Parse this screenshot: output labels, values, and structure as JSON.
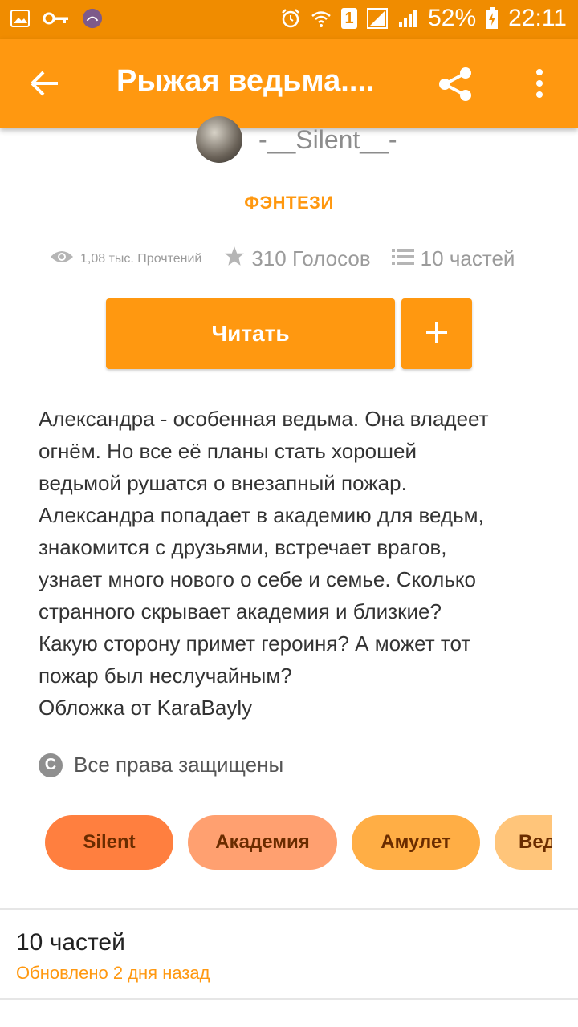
{
  "status_bar": {
    "battery": "52%",
    "time": "22:11",
    "sim_badge": "1",
    "left_icons": [
      "gallery-icon",
      "key-icon",
      "app-notification-icon"
    ],
    "right_icons": [
      "alarm-icon",
      "wifi-icon",
      "signal-icon",
      "battery-charging-icon"
    ]
  },
  "app_bar": {
    "title": "Рыжая ведьма....",
    "back_icon": "arrow-back-icon",
    "share_icon": "share-icon",
    "more_icon": "more-vert-icon"
  },
  "story": {
    "author": "-__Silent__-",
    "genre": "ФЭНТЕЗИ",
    "reads": "1,08 тыс. Прочтений",
    "votes": "310 Голосов",
    "parts": "10 частей",
    "read_button": "Читать",
    "add_button_icon": "plus-icon",
    "description": "Александра - особенная ведьма. Она владеет\nогнём. Но все её планы стать хорошей\nведьмой рушатся о внезапный пожар.\nАлександра попадает в академию для ведьм,\nзнакомится с друзьями, встречает врагов,\nузнает много нового о себе и семье. Сколько\nстранного скрывает академия и близкие?\nКакую сторону примет героиня? А может тот\nпожар был неслучайным?\nОбложка от KaraBayly",
    "copyright": "Все права защищены"
  },
  "tags": [
    {
      "label": "Silent",
      "color": "#ff7f3f"
    },
    {
      "label": "Академия",
      "color": "#ffa070"
    },
    {
      "label": "Амулет",
      "color": "#ffae45"
    },
    {
      "label": "Ведьма",
      "color": "#ffc57a"
    }
  ],
  "parts_section": {
    "title": "10 частей",
    "updated": "Обновлено 2 дня назад"
  },
  "colors": {
    "primary": "#ff9810",
    "status_bar": "#f08c00",
    "text_muted": "#9b9b9b"
  }
}
